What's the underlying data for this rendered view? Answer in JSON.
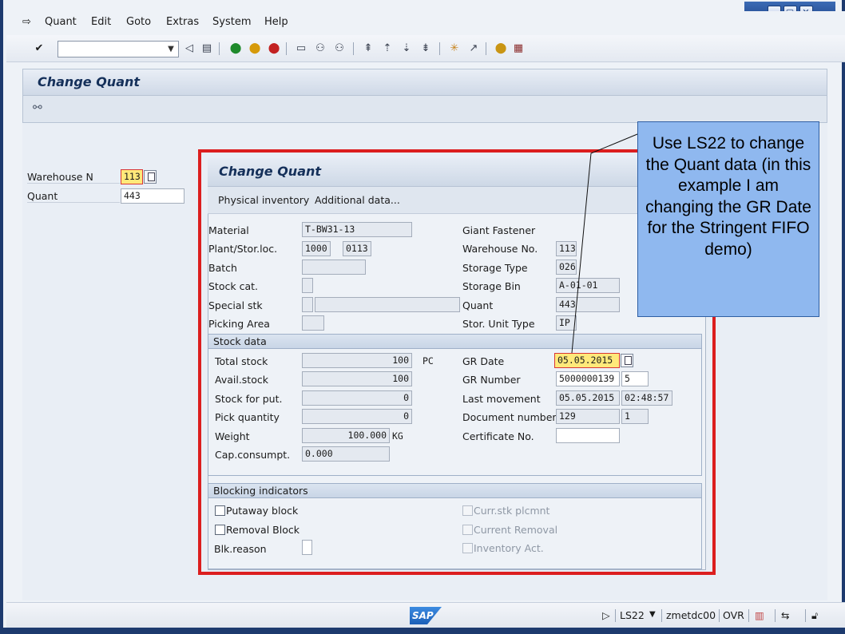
{
  "menu": {
    "items": [
      "Quant",
      "Edit",
      "Goto",
      "Extras",
      "System",
      "Help"
    ]
  },
  "window_controls": {
    "minimize": "▁",
    "restore": "▢",
    "close": "✕"
  },
  "toolbar": {
    "command_value": "",
    "icons": [
      "enter-icon",
      "back-icon",
      "save-icon",
      "green-back-icon",
      "exit-icon",
      "cancel-icon",
      "print-icon",
      "find-icon",
      "find-next-icon",
      "first-page-icon",
      "prev-page-icon",
      "next-page-icon",
      "last-page-icon",
      "create-session-icon",
      "shortcut-icon",
      "help-icon",
      "layout-icon"
    ]
  },
  "screen": {
    "title": "Change Quant"
  },
  "selection": {
    "warehouse_label": "Warehouse N",
    "warehouse_value": "113",
    "quant_label": "Quant",
    "quant_value": "443"
  },
  "popup": {
    "title": "Change Quant",
    "tabs": [
      "Physical inventory",
      "Additional data..."
    ],
    "left_fields": [
      {
        "label": "Material",
        "value": "T-BW31-13"
      },
      {
        "label": "Plant/Stor.loc.",
        "value": "1000",
        "value2": "0113"
      },
      {
        "label": "Batch",
        "value": ""
      },
      {
        "label": "Stock cat.",
        "value": ""
      },
      {
        "label": "Special stk",
        "value": "",
        "value2": ""
      },
      {
        "label": "Picking Area",
        "value": ""
      }
    ],
    "material_description": "Giant Fastener",
    "right_fields": [
      {
        "label": "Warehouse No.",
        "value": "113"
      },
      {
        "label": "Storage Type",
        "value": "026"
      },
      {
        "label": "Storage Bin",
        "value": "A-01-01"
      },
      {
        "label": "Quant",
        "value": "443"
      },
      {
        "label": "Stor. Unit Type",
        "value": "IP"
      }
    ],
    "stock_data": {
      "title": "Stock data",
      "left": [
        {
          "label": "Total stock",
          "value": "100",
          "unit": "PC"
        },
        {
          "label": "Avail.stock",
          "value": "100"
        },
        {
          "label": "Stock for put.",
          "value": "0"
        },
        {
          "label": "Pick quantity",
          "value": "0"
        },
        {
          "label": "Weight",
          "value": "100.000",
          "unit": "KG"
        },
        {
          "label": "Cap.consumpt.",
          "value": "0.000"
        }
      ],
      "gr_date_label": "GR Date",
      "gr_date_value": "05.05.2015",
      "gr_number_label": "GR Number",
      "gr_number_value": "5000000139",
      "gr_number_item": "5",
      "last_movement_label": "Last movement",
      "last_movement_date": "05.05.2015",
      "last_movement_time": "02:48:57",
      "document_number_label": "Document number",
      "document_number_value": "129",
      "document_item": "1",
      "certificate_label": "Certificate No.",
      "certificate_value": ""
    },
    "blocking": {
      "title": "Blocking indicators",
      "putaway_block": "Putaway block",
      "removal_block": "Removal Block",
      "blk_reason": "Blk.reason",
      "blk_reason_value": "",
      "curr_stk_plcmnt": "Curr.stk plcmnt",
      "current_removal": "Current Removal",
      "inventory_act": "Inventory Act."
    }
  },
  "callout": {
    "text": "Use LS22 to change the Quant data (in this example I am changing the GR Date for the Stringent FIFO demo)"
  },
  "status": {
    "logo": "SAP",
    "transaction": "LS22",
    "server": "zmetdc00",
    "mode": "OVR"
  },
  "colors": {
    "highlight_border": "#dc1e1e",
    "highlight_fill": "#ffe97a",
    "callout_fill": "#8fb8ef"
  }
}
